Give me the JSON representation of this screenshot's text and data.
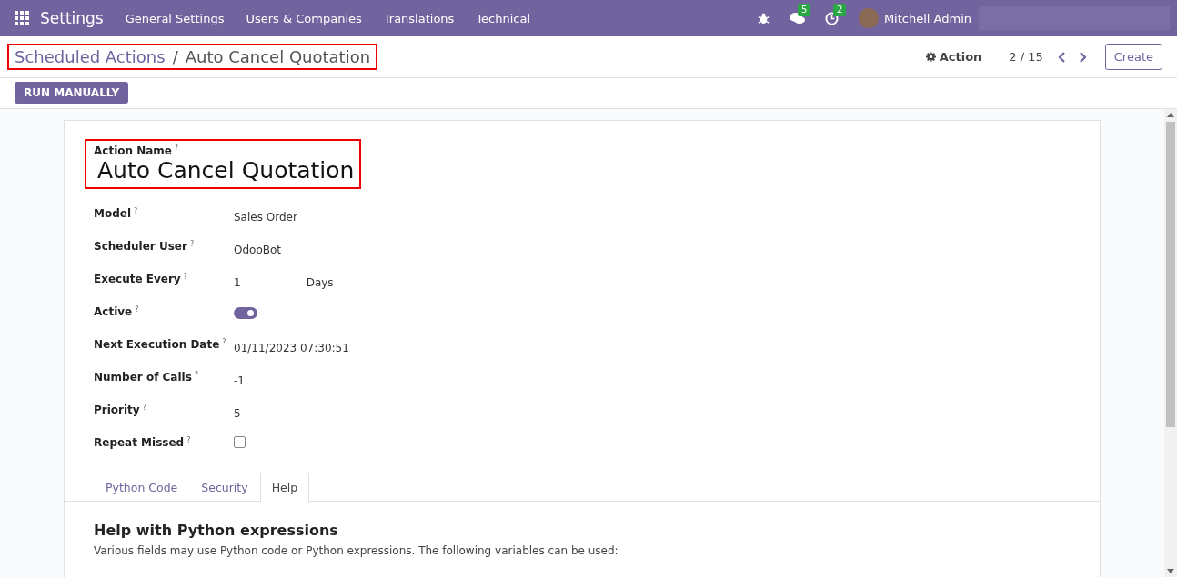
{
  "navbar": {
    "app": "Settings",
    "menu": [
      "General Settings",
      "Users & Companies",
      "Translations",
      "Technical"
    ],
    "messages_badge": "5",
    "activities_badge": "2",
    "user": "Mitchell Admin"
  },
  "breadcrumb": {
    "parent": "Scheduled Actions",
    "separator": "/",
    "current": "Auto Cancel Quotation"
  },
  "control": {
    "action": "Action",
    "pager": "2 / 15",
    "create": "Create",
    "run": "RUN MANUALLY"
  },
  "form": {
    "name_label": "Action Name",
    "name_hint": "?",
    "name": "Auto Cancel Quotation",
    "fields": [
      {
        "kind": "text",
        "label": "Model",
        "hint": "?",
        "value": "Sales Order"
      },
      {
        "kind": "text",
        "label": "Scheduler User",
        "hint": "?",
        "value": "OdooBot"
      },
      {
        "kind": "pair",
        "label": "Execute Every",
        "hint": "?",
        "value": "1",
        "unit": "Days"
      },
      {
        "kind": "toggle",
        "label": "Active",
        "hint": "?",
        "on": true
      },
      {
        "kind": "text",
        "label": "Next Execution Date",
        "hint": "?",
        "value": "01/11/2023 07:30:51"
      },
      {
        "kind": "text",
        "label": "Number of Calls",
        "hint": "?",
        "value": "-1"
      },
      {
        "kind": "text",
        "label": "Priority",
        "hint": "?",
        "value": "5"
      },
      {
        "kind": "checkbox",
        "label": "Repeat Missed",
        "hint": "?",
        "checked": false
      }
    ],
    "tabs": [
      {
        "label": "Python Code",
        "selected": false
      },
      {
        "label": "Security",
        "selected": false
      },
      {
        "label": "Help",
        "selected": true
      }
    ],
    "help_title": "Help with Python expressions",
    "help_text": "Various fields may use Python code or Python expressions. The following variables can be used:"
  }
}
